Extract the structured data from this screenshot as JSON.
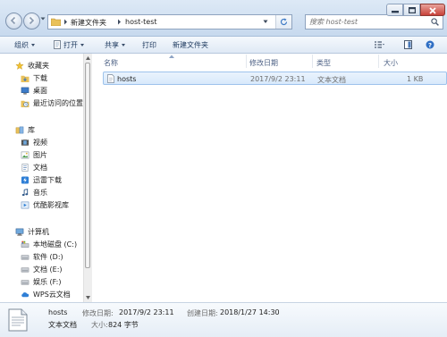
{
  "window": {
    "minimize_icon": "minimize-icon",
    "maximize_icon": "maximize-icon",
    "close_icon": "close-icon",
    "close_color": "#c8413a"
  },
  "address": {
    "crumbs": [
      "新建文件夹",
      "host-test"
    ]
  },
  "search": {
    "placeholder": "搜索 host-test"
  },
  "toolbar": {
    "organize": "组织",
    "open": "打开",
    "share": "共享",
    "print": "打印",
    "new_folder": "新建文件夹"
  },
  "navpane": {
    "favorites": {
      "title": "收藏夹",
      "items": [
        "下载",
        "桌面",
        "最近访问的位置"
      ]
    },
    "libraries": {
      "title": "库",
      "items": [
        "视频",
        "图片",
        "文档",
        "迅雷下载",
        "音乐",
        "优酷影视库"
      ]
    },
    "computer": {
      "title": "计算机",
      "items": [
        "本地磁盘 (C:)",
        "软件 (D:)",
        "文档 (E:)",
        "娱乐 (F:)",
        "WPS云文档"
      ]
    }
  },
  "columns": {
    "name": "名称",
    "modified": "修改日期",
    "type": "类型",
    "size": "大小"
  },
  "files": [
    {
      "name": "hosts",
      "modified": "2017/9/2 23:11",
      "type": "文本文档",
      "size": "1 KB"
    }
  ],
  "details": {
    "name": "hosts",
    "type": "文本文档",
    "modified_label": "修改日期:",
    "modified_value": "2017/9/2 23:11",
    "size_label": "大小:",
    "size_value": "824 字节",
    "created_label": "创建日期:",
    "created_value": "2018/1/27 14:30"
  }
}
